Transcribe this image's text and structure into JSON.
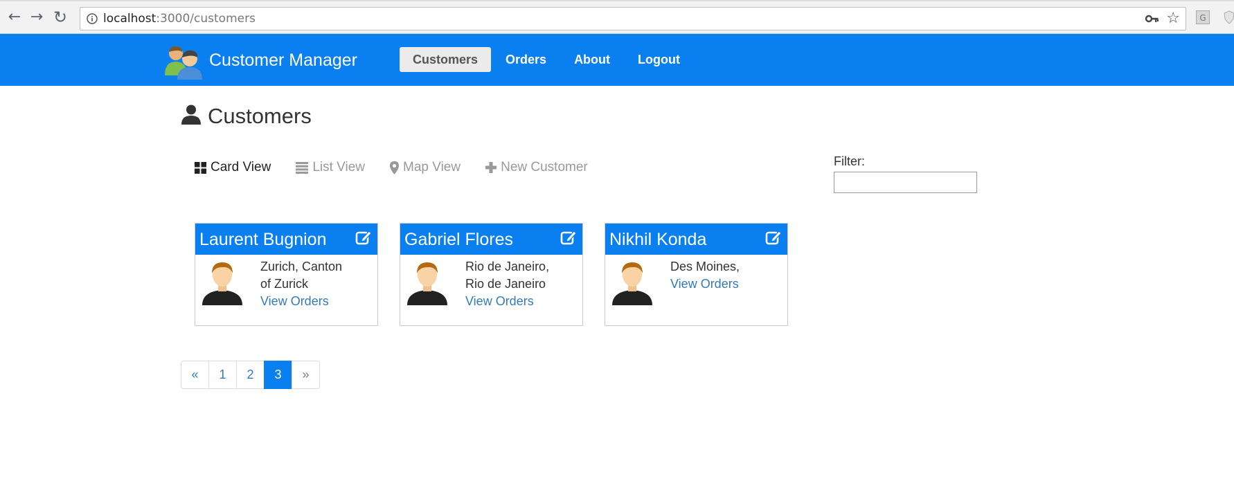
{
  "browser": {
    "url_host": "localhost",
    "url_path": ":3000/customers",
    "extension_label": "G"
  },
  "navbar": {
    "brand": "Customer Manager",
    "links": [
      {
        "label": "Customers",
        "active": true
      },
      {
        "label": "Orders",
        "active": false
      },
      {
        "label": "About",
        "active": false
      },
      {
        "label": "Logout",
        "active": false
      }
    ]
  },
  "page": {
    "title": "Customers",
    "views": {
      "card": "Card View",
      "list": "List View",
      "map": "Map View",
      "new": "New Customer"
    },
    "filter_label": "Filter:",
    "filter_value": ""
  },
  "customers": [
    {
      "name": "Laurent Bugnion",
      "line1": "Zurich, Canton",
      "line2": "of Zurick",
      "link": "View Orders"
    },
    {
      "name": "Gabriel Flores",
      "line1": "Rio de Janeiro,",
      "line2": "Rio de Janeiro",
      "link": "View Orders"
    },
    {
      "name": "Nikhil Konda",
      "line1": "Des Moines,",
      "line2": "",
      "link": "View Orders"
    }
  ],
  "pagination": {
    "prev": "«",
    "pages": [
      "1",
      "2",
      "3"
    ],
    "current": "3",
    "next": "»"
  },
  "colors": {
    "brand_blue": "#0a80f0",
    "link_blue": "#337ab7"
  }
}
